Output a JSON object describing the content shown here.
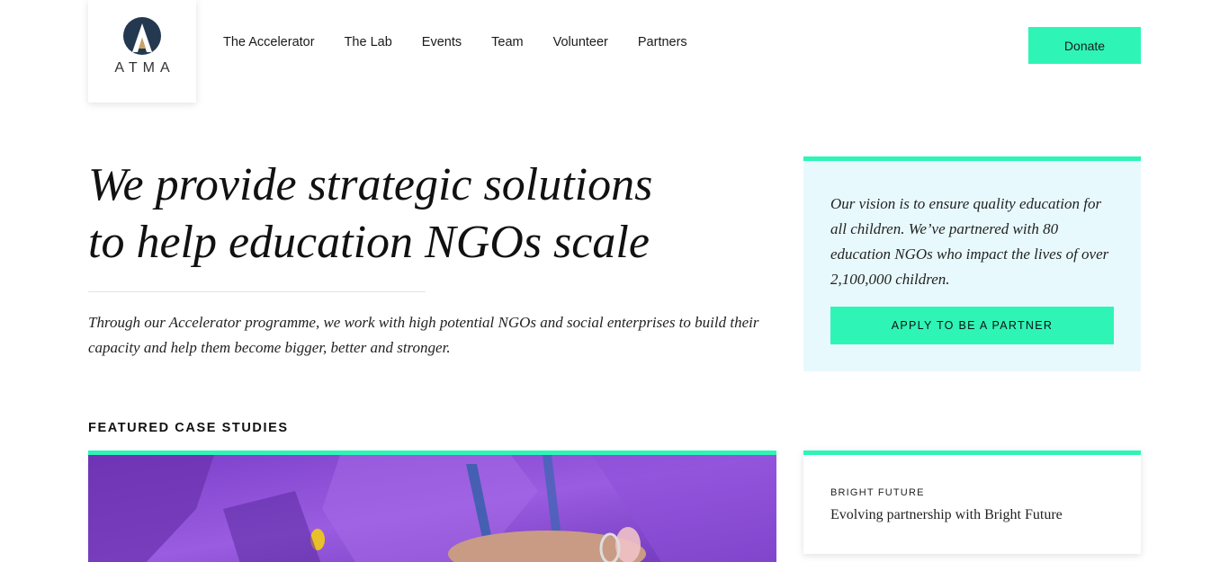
{
  "brand": {
    "logo_text": "ATMA"
  },
  "nav": {
    "items": [
      {
        "label": "The Accelerator"
      },
      {
        "label": "The Lab"
      },
      {
        "label": "Events"
      },
      {
        "label": "Team"
      },
      {
        "label": "Volunteer"
      },
      {
        "label": "Partners"
      }
    ],
    "donate_label": "Donate"
  },
  "hero": {
    "title_line1": "We provide strategic solutions",
    "title_line2": "to help education NGOs scale",
    "subtitle": "Through our Accelerator programme, we work with high potential NGOs and social enterprises to build their capacity and help them become bigger, better and stronger."
  },
  "vision": {
    "text": "Our vision is to ensure quality education for all children. We’ve partnered with 80 education NGOs who impact the lives of over 2,100,000 children.",
    "apply_label": "APPLY TO BE A PARTNER"
  },
  "featured": {
    "heading": "FEATURED CASE STUDIES",
    "case": {
      "tag": "BRIGHT FUTURE",
      "title": "Evolving partnership with Bright Future"
    }
  },
  "colors": {
    "accent": "#2ef5b5",
    "vision_bg": "#e8f9fd",
    "photo_purple": "#8a4fd4"
  }
}
